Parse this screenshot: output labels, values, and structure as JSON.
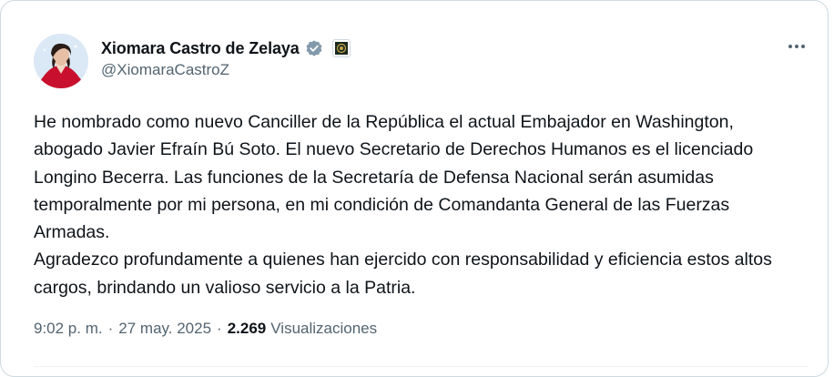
{
  "author": {
    "display_name": "Xiomara Castro de Zelaya",
    "handle": "@XiomaraCastroZ",
    "verified_color": "#829aab"
  },
  "tweet": {
    "paragraph_1": "He nombrado como nuevo Canciller de la República el actual Embajador en Washington, abogado Javier Efraín Bú Soto. El nuevo Secretario de Derechos Humanos es el licenciado Longino Becerra. Las funciones de la Secretaría de Defensa Nacional serán asumidas temporalmente por mi persona, en mi condición de Comandanta General de las Fuerzas Armadas.",
    "paragraph_2": "Agradezco profundamente a quienes han ejercido con responsabilidad y eficiencia estos altos cargos, brindando un valioso servicio a la Patria."
  },
  "meta": {
    "time": "9:02 p. m.",
    "separator": "·",
    "date": "27 may. 2025",
    "views_count": "2.269",
    "views_label": "Visualizaciones"
  },
  "icons": {
    "more": "more-options-icon",
    "verified": "verified-badge-icon",
    "affiliate": "government-affiliation-icon"
  }
}
